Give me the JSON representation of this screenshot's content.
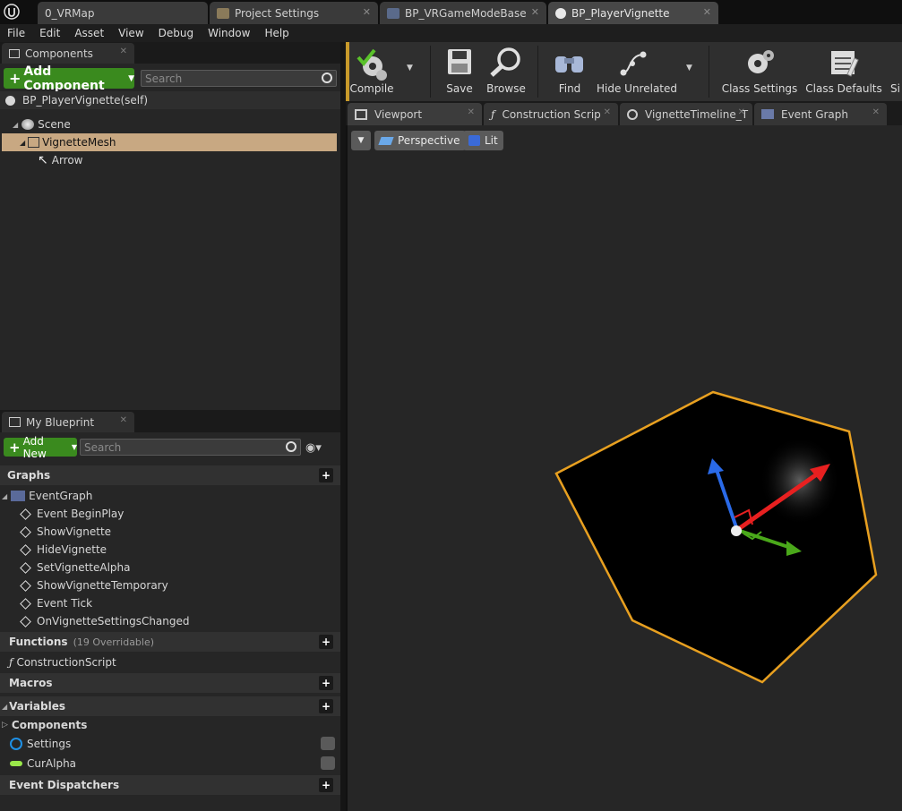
{
  "doc_tabs": [
    {
      "label": "0_VRMap"
    },
    {
      "label": "Project Settings"
    },
    {
      "label": "BP_VRGameModeBase"
    },
    {
      "label": "BP_PlayerVignette"
    }
  ],
  "menu": [
    "File",
    "Edit",
    "Asset",
    "View",
    "Debug",
    "Window",
    "Help"
  ],
  "components_panel": {
    "title": "Components",
    "add_button": "Add Component",
    "search_placeholder": "Search",
    "self_label": "BP_PlayerVignette(self)",
    "tree": [
      "Scene",
      "VignetteMesh",
      "Arrow"
    ]
  },
  "my_blueprint": {
    "title": "My Blueprint",
    "add_button": "Add New",
    "search_placeholder": "Search",
    "graphs_label": "Graphs",
    "event_graph": "EventGraph",
    "events": [
      "Event BeginPlay",
      "ShowVignette",
      "HideVignette",
      "SetVignetteAlpha",
      "ShowVignetteTemporary",
      "Event Tick",
      "OnVignetteSettingsChanged"
    ],
    "functions_label": "Functions",
    "functions_note": "(19 Overridable)",
    "function_items": [
      "ConstructionScript"
    ],
    "macros_label": "Macros",
    "variables_label": "Variables",
    "components_label": "Components",
    "variables": [
      "Settings",
      "CurAlpha"
    ],
    "dispatchers_label": "Event Dispatchers"
  },
  "toolbar": {
    "compile": "Compile",
    "save": "Save",
    "browse": "Browse",
    "find": "Find",
    "hide_unrelated": "Hide Unrelated",
    "class_settings": "Class Settings",
    "class_defaults": "Class Defaults",
    "simulation_cut": "Si"
  },
  "editor_tabs": [
    "Viewport",
    "Construction Scrip",
    "VignetteTimeline_T",
    "Event Graph"
  ],
  "viewport": {
    "perspective": "Perspective",
    "lit": "Lit"
  },
  "colors": {
    "accent_green": "#3a8a1e",
    "selection": "#c8a882",
    "outline": "#e8a020"
  }
}
